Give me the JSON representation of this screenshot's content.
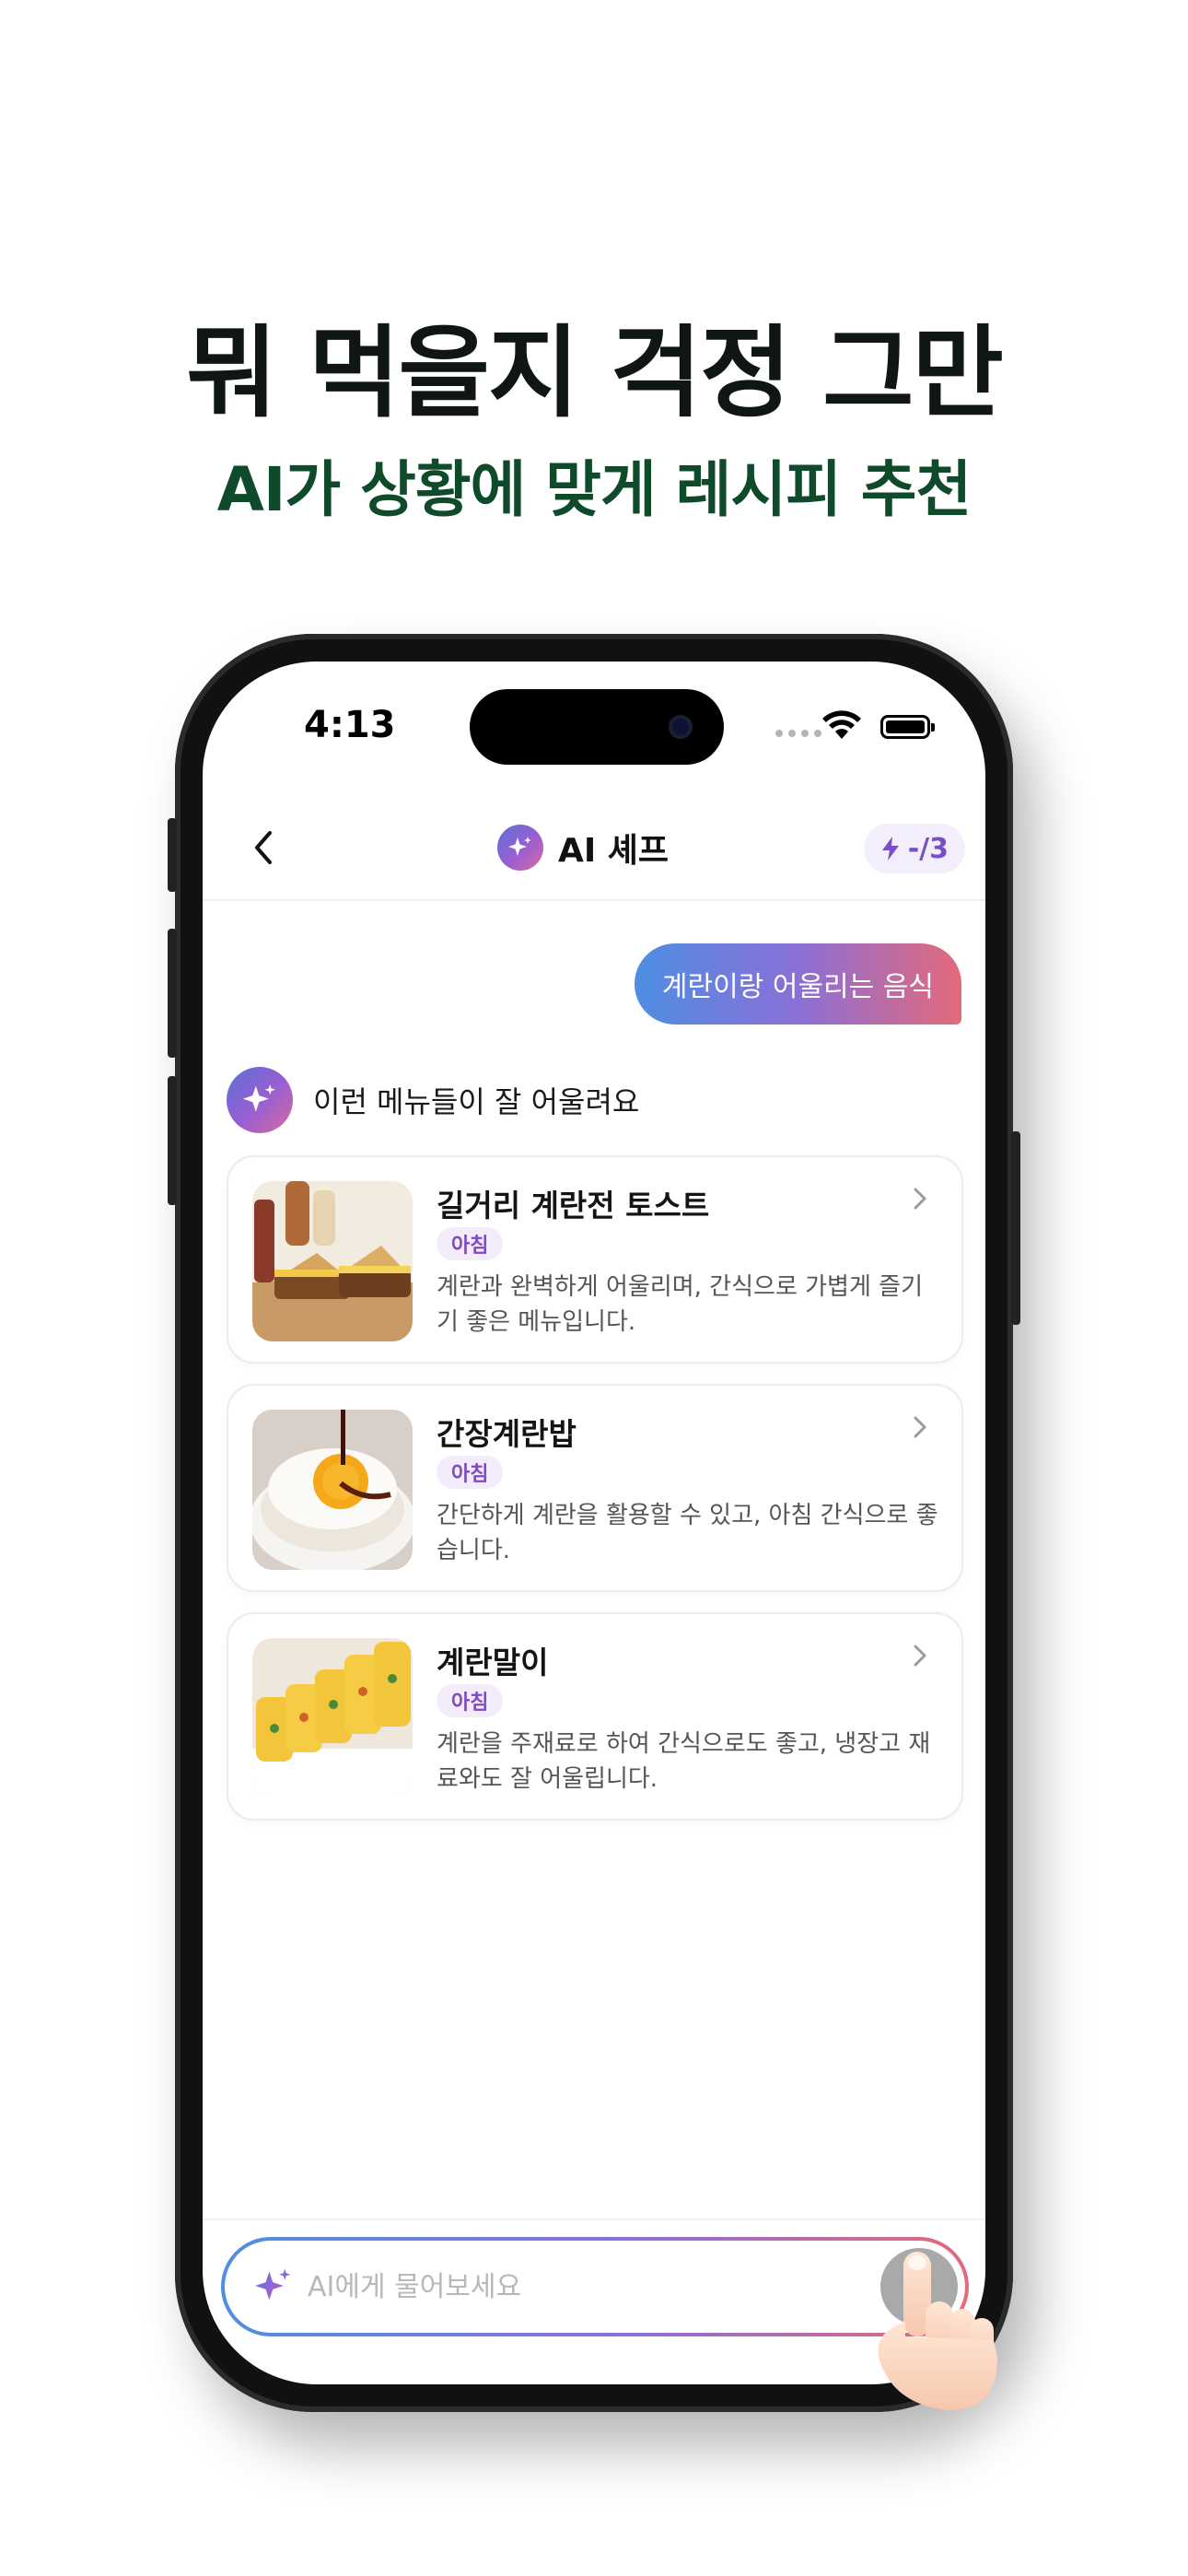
{
  "promo": {
    "headline": "뭐 먹을지 걱정 그만",
    "subline": "AI가 상황에 맞게 레시피 추천"
  },
  "status_bar": {
    "time": "4:13"
  },
  "header": {
    "back_icon": "chevron-left-icon",
    "title": "AI 셰프",
    "credit_label": "-/3",
    "credit_icon": "lightning-icon"
  },
  "chat": {
    "user_message": "계란이랑 어울리는 음식",
    "ai_message": "이런 메뉴들이 잘 어울려요",
    "recipes": [
      {
        "title": "길거리 계란전 토스트",
        "tag": "아침",
        "description": "계란과 완벽하게 어울리며, 간식으로 가볍게 즐기기 좋은 메뉴입니다."
      },
      {
        "title": "간장계란밥",
        "tag": "아침",
        "description": "간단하게 계란을 활용할 수 있고, 아침 간식으로 좋습니다."
      },
      {
        "title": "계란말이",
        "tag": "아침",
        "description": "계란을 주재료로 하여 간식으로도 좋고, 냉장고 재료와도 잘 어울립니다."
      }
    ]
  },
  "composer": {
    "placeholder": "AI에게 물어보세요",
    "send_icon": "arrow-up-icon"
  },
  "colors": {
    "headline": "#101614",
    "subline": "#0f4a2a",
    "accent_purple": "#7a4fc6",
    "gradient_start": "#4f8ee3",
    "gradient_end": "#e46a7a"
  }
}
